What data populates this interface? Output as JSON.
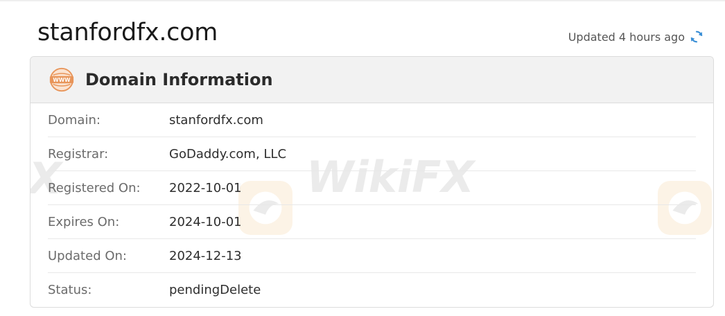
{
  "header": {
    "domain_title": "stanfordfx.com",
    "updated_text": "Updated 4 hours ago"
  },
  "card": {
    "title": "Domain Information",
    "rows": [
      {
        "label": "Domain:",
        "value": "stanfordfx.com"
      },
      {
        "label": "Registrar:",
        "value": "GoDaddy.com, LLC"
      },
      {
        "label": "Registered On:",
        "value": "2022-10-01"
      },
      {
        "label": "Expires On:",
        "value": "2024-10-01"
      },
      {
        "label": "Updated On:",
        "value": "2024-12-13"
      },
      {
        "label": "Status:",
        "value": "pendingDelete"
      }
    ]
  },
  "watermark": {
    "text": "WikiFX",
    "left_fragment": "FX"
  },
  "icons": {
    "header_icon": "www-globe-icon",
    "refresh_icon": "refresh-icon"
  },
  "colors": {
    "accent_orange": "#e8955a",
    "refresh_blue": "#3b8fd6",
    "header_bg": "#f2f2f2"
  }
}
